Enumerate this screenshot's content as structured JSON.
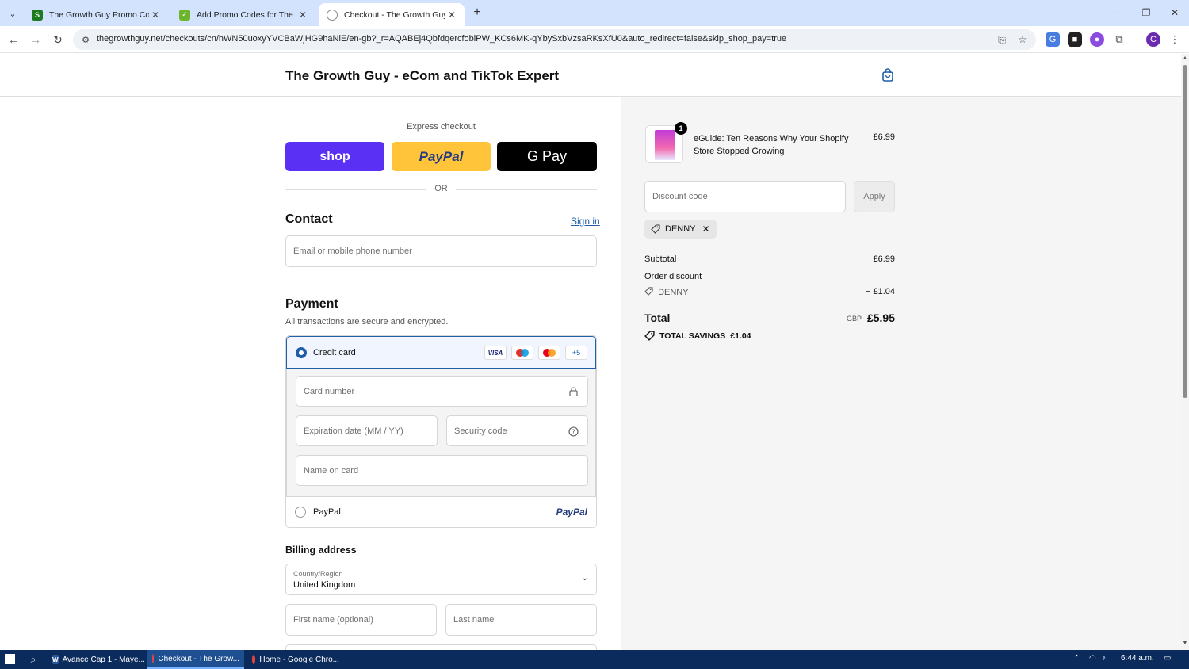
{
  "browser": {
    "tabs": [
      {
        "title": "The Growth Guy Promo Code -",
        "active": false,
        "favicon_color": "#2c7a2c"
      },
      {
        "title": "Add Promo Codes for The Grow",
        "active": false,
        "favicon_color": "#2c7a2c"
      },
      {
        "title": "Checkout - The Growth Guy - e",
        "active": true,
        "favicon_color": "#666666"
      }
    ],
    "url": "thegrowthguy.net/checkouts/cn/hWN50uoxyYVCBaWjHG9haNiE/en-gb?_r=AQABEj4QbfdqercfobiPW_KCs6MK-qYbySxbVzsaRKsXfU0&auto_redirect=false&skip_shop_pay=true",
    "profile_initial": "C"
  },
  "header": {
    "store_title": "The Growth Guy - eCom and TikTok Expert"
  },
  "express": {
    "label": "Express checkout",
    "shop_label": "shop",
    "paypal_label": "PayPal",
    "gpay_label": "G Pay",
    "or_label": "OR"
  },
  "contact": {
    "heading": "Contact",
    "sign_in": "Sign in",
    "email_placeholder": "Email or mobile phone number"
  },
  "payment": {
    "heading": "Payment",
    "subtitle": "All transactions are secure and encrypted.",
    "credit_card_label": "Credit card",
    "card_brands": [
      "VISA",
      "Maestro",
      "Mastercard"
    ],
    "more_brands": "+5",
    "card_number_placeholder": "Card number",
    "expiry_placeholder": "Expiration date (MM / YY)",
    "security_placeholder": "Security code",
    "name_placeholder": "Name on card",
    "paypal_label": "PayPal",
    "paypal_logo": "PayPal"
  },
  "billing": {
    "heading": "Billing address",
    "country_label": "Country/Region",
    "country_value": "United Kingdom",
    "first_name_placeholder": "First name (optional)",
    "last_name_placeholder": "Last name"
  },
  "summary": {
    "quantity": "1",
    "product_name": "eGuide: Ten Reasons Why Your Shopify Store Stopped Growing",
    "product_price": "£6.99",
    "discount_placeholder": "Discount code",
    "apply_label": "Apply",
    "applied_code": "DENNY",
    "subtotal_label": "Subtotal",
    "subtotal_value": "£6.99",
    "order_discount_label": "Order discount",
    "discount_code": "DENNY",
    "discount_value": "− £1.04",
    "total_label": "Total",
    "currency": "GBP",
    "total_value": "£5.95",
    "savings_label": "TOTAL SAVINGS",
    "savings_value": "£1.04"
  },
  "taskbar": {
    "apps": [
      {
        "label": "Avance Cap 1 - Maye...",
        "active": false
      },
      {
        "label": "Checkout - The Grow...",
        "active": true
      },
      {
        "label": "Home - Google Chro...",
        "active": false
      }
    ],
    "time": "6:44 a.m."
  },
  "colors": {
    "accent": "#1f5fa8",
    "shop_pay": "#5a31f4",
    "paypal": "#ffc439"
  }
}
